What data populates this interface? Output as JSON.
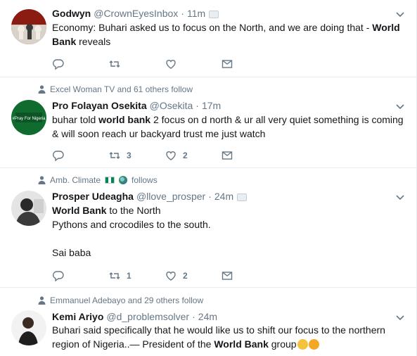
{
  "colors": {
    "text": "#14171a",
    "muted": "#657786",
    "border": "#e6ecf0",
    "accent": "#1da1f2"
  },
  "tweets": [
    {
      "social": "",
      "name": "Godwyn",
      "handle": "@CrownEyesInbox",
      "time": "11m",
      "text_before": "Economy: Buhari asked us to focus on the North, and we are doing that - ",
      "text_bold": "World Bank",
      "text_after": " reveals",
      "retweets": "",
      "likes": ""
    },
    {
      "social": "Excel Woman TV and 61 others follow",
      "name": "Pro Folayan Osekita",
      "handle": "@Osekita",
      "time": "17m",
      "text_before": "buhar told ",
      "text_bold": "world bank",
      "text_after": " 2 focus on d north & ur all very quiet something is coming & will soon reach ur backyard trust me just watch",
      "retweets": "3",
      "likes": "2"
    },
    {
      "social": "Amb. Climate",
      "social_suffix": "follows",
      "name": "Prosper Udeagha",
      "handle": "@llove_prosper",
      "time": "24m",
      "text_bold": "World Bank",
      "text_line1": " to the North",
      "text_line2": "Pythons and crocodiles to the south.",
      "text_line3": "Sai baba",
      "retweets": "1",
      "likes": "2"
    },
    {
      "social": "Emmanuel Adebayo and 29 others follow",
      "name": "Kemi Ariyo",
      "handle": "@d_problemsolver",
      "time": "24m",
      "text_before": "Buhari said specifically that he would like us to shift our focus to the northern region of Nigeria..— President of the ",
      "text_bold": "World Bank",
      "text_after": " group"
    }
  ],
  "separator": "·",
  "avatar2_text": "#Pray For Nigeria"
}
